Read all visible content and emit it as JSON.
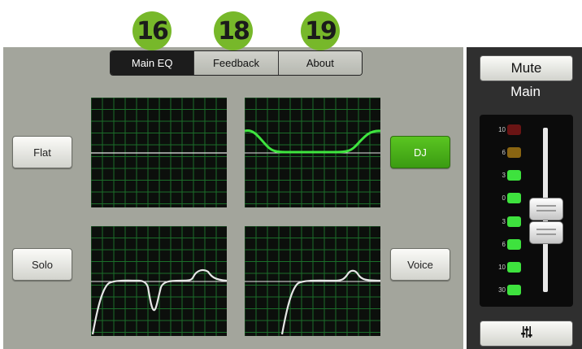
{
  "callouts": [
    "16",
    "18",
    "19"
  ],
  "tabs": [
    {
      "label": "Main EQ",
      "active": true
    },
    {
      "label": "Feedback",
      "active": false
    },
    {
      "label": "About",
      "active": false
    }
  ],
  "presets": {
    "flat": "Flat",
    "dj": "DJ",
    "solo": "Solo",
    "voice": "Voice",
    "active": "DJ"
  },
  "channel": {
    "mute_label": "Mute",
    "name": "Main",
    "meter_ticks": [
      "10",
      "6",
      "3",
      "0",
      "3",
      "6",
      "10",
      "30"
    ],
    "settings_icon": "mixer-sliders-icon"
  },
  "colors": {
    "accent_green": "#56c21e",
    "callout_green": "#77b82a",
    "grid_line": "#1b6e2a",
    "eq_curve_active": "#3fe53f",
    "eq_curve_inactive": "#e6e6e6",
    "led_red": "#6a1414",
    "led_amber": "#8a6512",
    "led_green": "#3ee23e"
  }
}
